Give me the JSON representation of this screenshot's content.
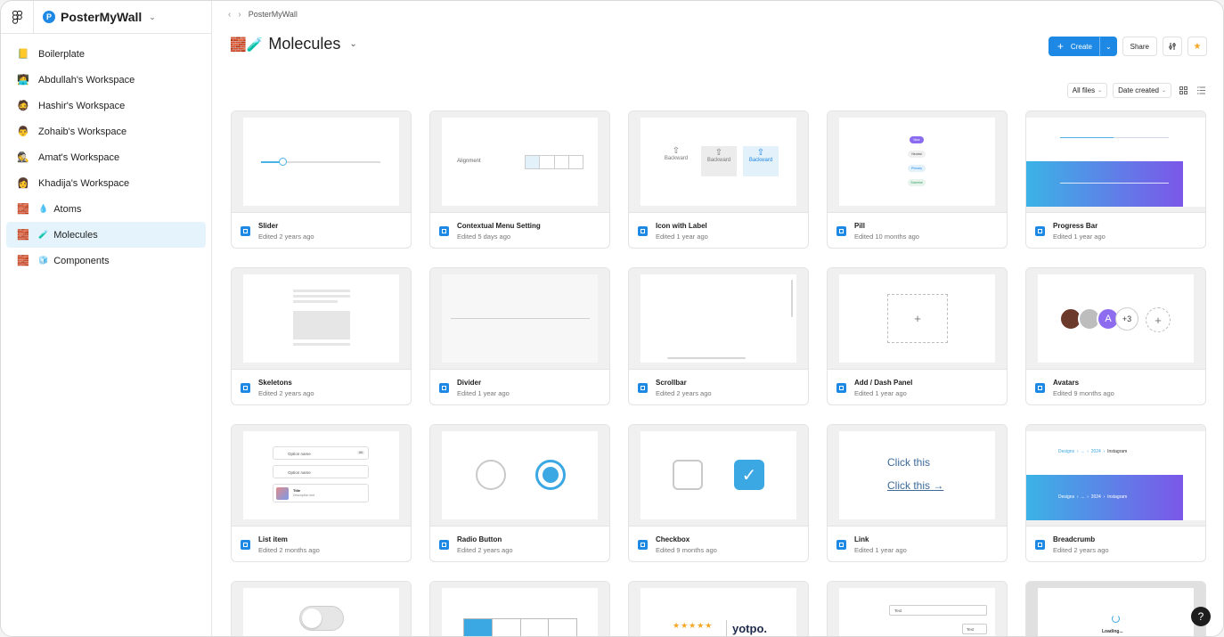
{
  "sidebar": {
    "team_name": "PosterMyWall",
    "team_badge": "P",
    "items": [
      {
        "emoji": "📒",
        "label": "Boilerplate"
      },
      {
        "emoji": "🧑‍💻",
        "label": "Abdullah's Workspace"
      },
      {
        "emoji": "🧔",
        "label": "Hashir's Workspace"
      },
      {
        "emoji": "👨",
        "label": "Zohaib's Workspace"
      },
      {
        "emoji": "🕵️",
        "label": "Amat's Workspace"
      },
      {
        "emoji": "👩",
        "label": "Khadija's Workspace"
      },
      {
        "emoji": "🧱",
        "emoji2": "💧",
        "label": "Atoms"
      },
      {
        "emoji": "🧱",
        "emoji2": "🧪",
        "label": "Molecules"
      },
      {
        "emoji": "🧱",
        "emoji2": "🧊",
        "label": "Components"
      }
    ]
  },
  "header": {
    "breadcrumb": "PosterMyWall",
    "title_icons": "🧱🧪",
    "title": "Molecules",
    "create_label": "Create",
    "share_label": "Share"
  },
  "filters": {
    "scope": "All files",
    "sort": "Date created"
  },
  "thumb_text": {
    "alignment": "Alignment",
    "backward": "Backward",
    "pills": [
      "New",
      "Neutral",
      "Primary",
      "Success"
    ],
    "option_name": "Option name",
    "option_tag": "Alt",
    "title": "Title",
    "description": "Description text",
    "click_this": "Click this",
    "crumbs": [
      "Designs",
      "...",
      "2024",
      "Instagram"
    ],
    "avatar_letter": "A",
    "avatar_more": "+3",
    "yotpo": "yotpo.",
    "text": "Text",
    "loading": "Loading..."
  },
  "files": [
    {
      "name": "Slider",
      "meta": "Edited 2 years ago"
    },
    {
      "name": "Contextual Menu Setting",
      "meta": "Edited 5 days ago"
    },
    {
      "name": "Icon with Label",
      "meta": "Edited 1 year ago"
    },
    {
      "name": "Pill",
      "meta": "Edited 10 months ago"
    },
    {
      "name": "Progress Bar",
      "meta": "Edited 1 year ago"
    },
    {
      "name": "Skeletons",
      "meta": "Edited 2 years ago"
    },
    {
      "name": "Divider",
      "meta": "Edited 1 year ago"
    },
    {
      "name": "Scrollbar",
      "meta": "Edited 2 years ago"
    },
    {
      "name": "Add / Dash Panel",
      "meta": "Edited 1 year ago"
    },
    {
      "name": "Avatars",
      "meta": "Edited 9 months ago"
    },
    {
      "name": "List item",
      "meta": "Edited 2 months ago"
    },
    {
      "name": "Radio Button",
      "meta": "Edited 2 years ago"
    },
    {
      "name": "Checkbox",
      "meta": "Edited 9 months ago"
    },
    {
      "name": "Link",
      "meta": "Edited 1 year ago"
    },
    {
      "name": "Breadcrumb",
      "meta": "Edited 2 years ago"
    }
  ],
  "help_label": "?"
}
